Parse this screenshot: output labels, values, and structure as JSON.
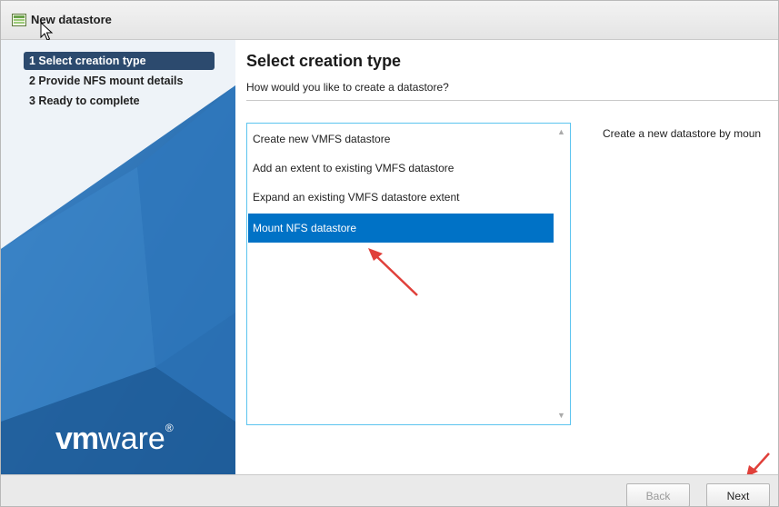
{
  "window": {
    "title": "New datastore"
  },
  "sidebar": {
    "steps": [
      {
        "label": "1 Select creation type",
        "active": true
      },
      {
        "label": "2 Provide NFS mount details",
        "active": false
      },
      {
        "label": "3 Ready to complete",
        "active": false
      }
    ],
    "logo": {
      "text_bold": "vm",
      "text_light": "ware",
      "trademark": "®"
    }
  },
  "main": {
    "heading": "Select creation type",
    "subheading": "How would you like to create a datastore?",
    "options": [
      {
        "label": "Create new VMFS datastore",
        "selected": false
      },
      {
        "label": "Add an extent to existing VMFS datastore",
        "selected": false
      },
      {
        "label": "Expand an existing VMFS datastore extent",
        "selected": false
      },
      {
        "label": "Mount NFS datastore",
        "selected": true
      }
    ],
    "description": "Create a new datastore by moun"
  },
  "footer": {
    "back_label": "Back",
    "next_label": "Next"
  },
  "icons": [
    "datastore-icon",
    "cursor-icon",
    "scroll-up-icon",
    "scroll-down-icon",
    "annotation-arrow-icon"
  ],
  "colors": {
    "accent": "#0072c6",
    "active_step": "#2c4a6e",
    "listbox_border": "#5cc4ef",
    "annotation": "#e0403a"
  }
}
